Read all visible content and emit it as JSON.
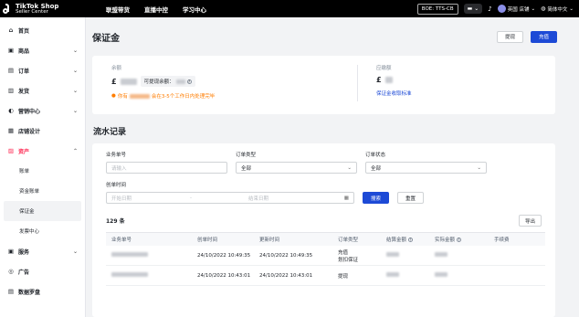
{
  "topbar": {
    "logo_line1": "TikTok Shop",
    "logo_line2": "Seller Center",
    "nav": [
      "联盟带货",
      "直播中控",
      "学习中心"
    ],
    "env_badge": "BOE: TTS-CB",
    "user_label": "英国 店铺",
    "lang_label": "简体中文"
  },
  "sidebar": {
    "items": [
      {
        "label": "首页",
        "icon": "home-icon",
        "glyph": "⌂"
      },
      {
        "label": "商品",
        "icon": "product-icon",
        "glyph": "▣",
        "chevron": "⌄"
      },
      {
        "label": "订单",
        "icon": "order-icon",
        "glyph": "▤",
        "chevron": "⌄"
      },
      {
        "label": "发货",
        "icon": "shipping-icon",
        "glyph": "▥",
        "chevron": "⌄"
      },
      {
        "label": "营销中心",
        "icon": "marketing-icon",
        "glyph": "◐",
        "chevron": "⌄"
      },
      {
        "label": "店铺设计",
        "icon": "store-design-icon",
        "glyph": "▦"
      },
      {
        "label": "资产",
        "icon": "assets-icon",
        "glyph": "▨",
        "chevron": "⌃"
      }
    ],
    "sub_items": [
      "账单",
      "资金账单",
      "保证金",
      "发票中心"
    ],
    "bottom_items": [
      {
        "label": "服务",
        "icon": "service-icon",
        "glyph": "▣",
        "chevron": "⌄"
      },
      {
        "label": "广告",
        "icon": "ads-icon",
        "glyph": "◎"
      },
      {
        "label": "数据罗盘",
        "icon": "data-icon",
        "glyph": "▤"
      }
    ]
  },
  "page": {
    "title": "保证金",
    "withdraw_label": "提现",
    "recharge_label": "充值"
  },
  "balance": {
    "label": "余额",
    "currency": "£",
    "withdrawable_label": "可提现余额：",
    "warning": "你有",
    "warning_tail": "会在3-5个工作日内处理完毕",
    "reserve_label": "应缴额",
    "reserve_currency": "£",
    "standard_link": "保证金收取标准"
  },
  "records": {
    "title": "流水记录",
    "filters": {
      "business_no_label": "业务单号",
      "business_no_placeholder": "请输入",
      "order_type_label": "订单类型",
      "order_type_value": "全部",
      "order_status_label": "订单状态",
      "order_status_value": "全部",
      "created_label": "创单时间",
      "start_placeholder": "开始日期",
      "end_placeholder": "结束日期",
      "search_label": "搜索",
      "reset_label": "重置"
    },
    "count_label": "129 条",
    "export_label": "导出",
    "columns": [
      "业务单号",
      "创单时间",
      "更新时间",
      "订单类型",
      "结算金额",
      "实际金额",
      "手续费"
    ],
    "rows": [
      {
        "created": "24/10/2022 10:49:35",
        "updated": "24/10/2022 10:49:35",
        "type": "充值",
        "type_note": "划扣保证"
      },
      {
        "created": "24/10/2022 10:43:01",
        "updated": "24/10/2022 10:43:01",
        "type": "提现",
        "type_note": ""
      }
    ]
  },
  "colors": {
    "topbar_bg": "#000000",
    "accent_blue": "#1d4ad6",
    "active_red": "#fe2c55",
    "warning_orange": "#ff7d00"
  }
}
